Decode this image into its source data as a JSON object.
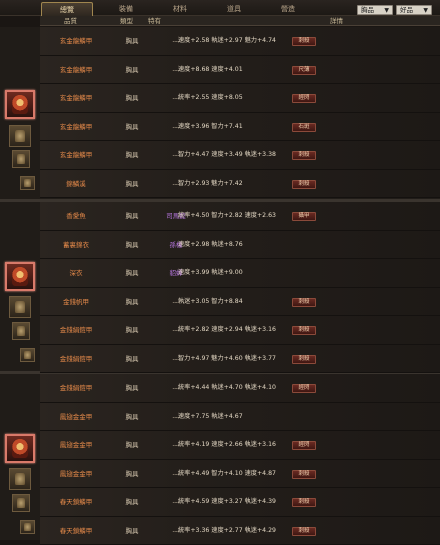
{
  "tabs": [
    "總覽",
    "裝備",
    "材料",
    "道具",
    "營造"
  ],
  "dropdowns": [
    "胸品",
    "好品"
  ],
  "header": {
    "name": "品質",
    "type": "類型",
    "spec": "特有",
    "stats": "詳情"
  },
  "rows": [
    {
      "name": "玄金龍鱗甲",
      "type": "胸具",
      "spec": "---",
      "stats": "速度+2.58  執迷+2.97  魅力+4.74",
      "badge": "刺殺"
    },
    {
      "name": "玄金龍鱗甲",
      "type": "胸具",
      "spec": "---",
      "stats": "速度+8.68  速度+4.01",
      "badge": "尺薄"
    },
    {
      "name": "玄金龍鱗甲",
      "type": "胸具",
      "spec": "---",
      "stats": "統率+2.55  速度+8.05",
      "badge": "經閃"
    },
    {
      "name": "玄金龍鱗甲",
      "type": "胸具",
      "spec": "---",
      "stats": "速度+3.96  智力+7.41",
      "badge": "石斑"
    },
    {
      "name": "玄金龍鱗甲",
      "type": "胸具",
      "spec": "---",
      "stats": "智力+4.47  速度+3.49  執迷+3.38",
      "badge": "刺殺"
    },
    {
      "name": "錦鱗溪",
      "type": "胸具",
      "spec": "---",
      "stats": "智力+2.93  魅力+7.42",
      "badge": "刺殺"
    },
    {
      "name": "香愛魚",
      "type": "胸具",
      "spec": "司馬懿",
      "spec_purple": true,
      "stats": "統率+4.50  智力+2.82  速度+2.63",
      "badge": "攝甲"
    },
    {
      "name": "蓄裏錦衣",
      "type": "胸具",
      "spec": "孫權",
      "spec_purple": true,
      "stats": "速度+2.98  執迷+8.76",
      "badge": ""
    },
    {
      "name": "深衣",
      "type": "胸具",
      "spec": "貂蟬",
      "spec_purple": true,
      "stats": "速度+3.99  執迷+9.00",
      "badge": ""
    },
    {
      "name": "金錢帆甲",
      "type": "胸具",
      "spec": "---",
      "stats": "執迷+3.05  智力+8.84",
      "badge": "刺殺"
    },
    {
      "name": "金錢絹鎧甲",
      "type": "胸具",
      "spec": "---",
      "stats": "統率+2.82  速度+2.94  執迷+3.16",
      "badge": "刺殺"
    },
    {
      "name": "金錢絹鎧甲",
      "type": "胸具",
      "spec": "---",
      "stats": "智力+4.97  魅力+4.60  執迷+3.77",
      "badge": "刺殺"
    },
    {
      "name": "金錢絹鎧甲",
      "type": "胸具",
      "spec": "---",
      "stats": "統率+4.44  執迷+4.70  執迷+4.10",
      "badge": "經閃"
    },
    {
      "name": "鳳翅金金甲",
      "type": "胸具",
      "spec": "---",
      "stats": "速度+7.75  執迷+4.67",
      "badge": ""
    },
    {
      "name": "鳳翅金金甲",
      "type": "胸具",
      "spec": "---",
      "stats": "統率+4.19  速度+2.66  執迷+3.16",
      "badge": "經閃"
    },
    {
      "name": "鳳翅金金甲",
      "type": "胸具",
      "spec": "---",
      "stats": "統率+4.49  智力+4.10  速度+4.87",
      "badge": "刺殺"
    },
    {
      "name": "春天鎖鱗甲",
      "type": "胸具",
      "spec": "---",
      "stats": "統率+4.59  速度+3.27  執迷+4.39",
      "badge": "刺殺"
    },
    {
      "name": "春天鎖鱗甲",
      "type": "胸具",
      "spec": "---",
      "stats": "統率+3.36  速度+2.77  執迷+4.29",
      "badge": "刺殺"
    }
  ]
}
